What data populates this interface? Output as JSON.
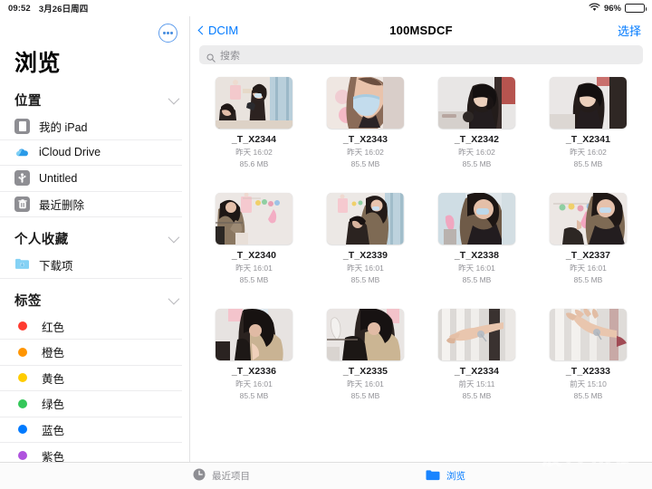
{
  "status_bar": {
    "time": "09:52",
    "date": "3月26日周四",
    "wifi_icon": "wifi-icon",
    "battery_percent": "96%",
    "battery_icon": "battery-icon"
  },
  "sidebar": {
    "title": "浏览",
    "more_button_icon": "ellipsis-circle-icon",
    "groups": [
      {
        "title": "位置",
        "collapse_icon": "chevron-down-icon",
        "items": [
          {
            "label": "我的 iPad",
            "icon": "ipad-icon"
          },
          {
            "label": "iCloud Drive",
            "icon": "icloud-icon"
          },
          {
            "label": "Untitled",
            "icon": "usb-drive-icon"
          },
          {
            "label": "最近删除",
            "icon": "trash-icon"
          }
        ]
      },
      {
        "title": "个人收藏",
        "collapse_icon": "chevron-down-icon",
        "items": [
          {
            "label": "下载项",
            "icon": "downloads-folder-icon"
          }
        ]
      },
      {
        "title": "标签",
        "collapse_icon": "chevron-down-icon",
        "items": [
          {
            "label": "红色",
            "icon": "tag-dot-icon",
            "color": "#FF3B30"
          },
          {
            "label": "橙色",
            "icon": "tag-dot-icon",
            "color": "#FF9500"
          },
          {
            "label": "黄色",
            "icon": "tag-dot-icon",
            "color": "#FFCC00"
          },
          {
            "label": "绿色",
            "icon": "tag-dot-icon",
            "color": "#34C759"
          },
          {
            "label": "蓝色",
            "icon": "tag-dot-icon",
            "color": "#007AFF"
          },
          {
            "label": "紫色",
            "icon": "tag-dot-icon",
            "color": "#AF52DE"
          }
        ]
      }
    ]
  },
  "navbar": {
    "back_label": "DCIM",
    "back_icon": "chevron-left-icon",
    "title": "100MSDCF",
    "action_label": "选择"
  },
  "search": {
    "placeholder": "搜索",
    "value": "",
    "icon": "search-icon"
  },
  "files": [
    {
      "name": "_T_X2344",
      "date": "昨天 16:02",
      "size": "85.6 MB"
    },
    {
      "name": "_T_X2343",
      "date": "昨天 16:02",
      "size": "85.5 MB"
    },
    {
      "name": "_T_X2342",
      "date": "昨天 16:02",
      "size": "85.5 MB"
    },
    {
      "name": "_T_X2341",
      "date": "昨天 16:02",
      "size": "85.5 MB"
    },
    {
      "name": "_T_X2340",
      "date": "昨天 16:01",
      "size": "85.5 MB"
    },
    {
      "name": "_T_X2339",
      "date": "昨天 16:01",
      "size": "85.5 MB"
    },
    {
      "name": "_T_X2338",
      "date": "昨天 16:01",
      "size": "85.5 MB"
    },
    {
      "name": "_T_X2337",
      "date": "昨天 16:01",
      "size": "85.5 MB"
    },
    {
      "name": "_T_X2336",
      "date": "昨天 16:01",
      "size": "85.5 MB"
    },
    {
      "name": "_T_X2335",
      "date": "昨天 16:01",
      "size": "85.5 MB"
    },
    {
      "name": "_T_X2334",
      "date": "前天 15:11",
      "size": "85.5 MB"
    },
    {
      "name": "_T_X2333",
      "date": "前天 15:10",
      "size": "85.5 MB"
    }
  ],
  "tabbar": {
    "tabs": [
      {
        "label": "最近项目",
        "icon": "clock-icon",
        "active": false
      },
      {
        "label": "浏览",
        "icon": "folder-icon",
        "active": true
      }
    ]
  },
  "watermark": {
    "text": "新浪众测"
  },
  "colors": {
    "accent": "#007AFF",
    "inactive": "#8E8E93",
    "search_field": "#ECECED",
    "separator": "#ECECEE"
  }
}
